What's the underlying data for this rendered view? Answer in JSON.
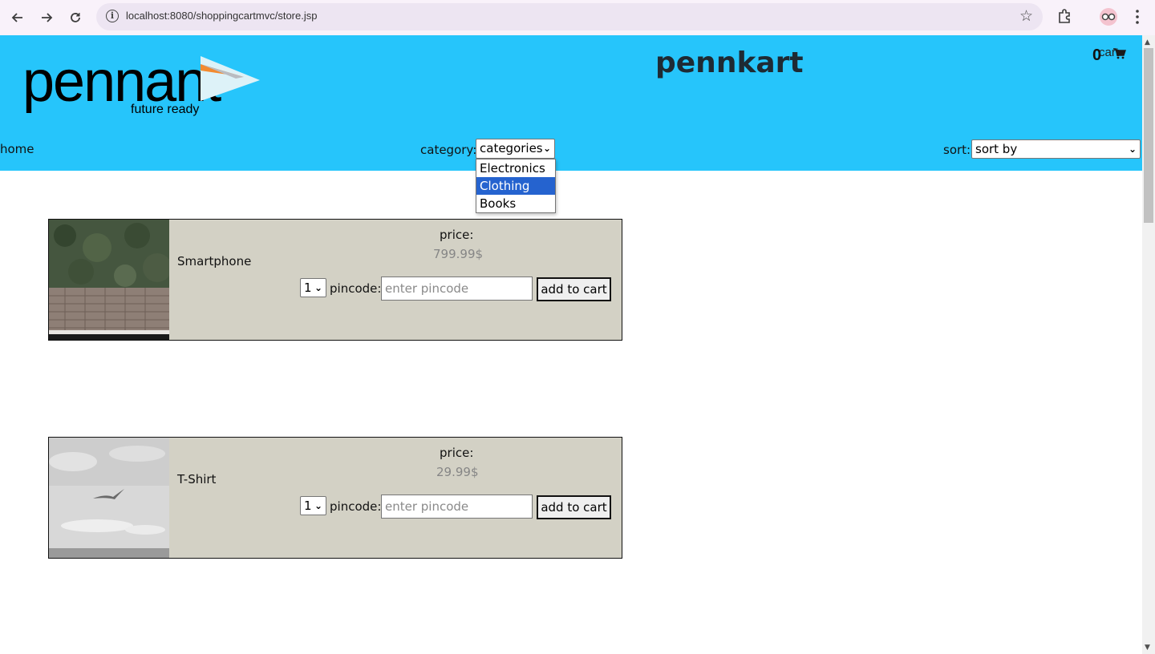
{
  "browser": {
    "url": "localhost:8080/shoppingcartmvc/store.jsp"
  },
  "header": {
    "logo_text": "pennant",
    "logo_tagline": "future ready",
    "site_title": "pennkart",
    "cart_count": "0",
    "cart_label": "cart"
  },
  "nav": {
    "home_label": "home",
    "category_label": "category:",
    "category_selected": "categories",
    "category_options": [
      "Electronics",
      "Clothing",
      "Books"
    ],
    "category_highlighted": "Clothing",
    "sort_label": "sort:",
    "sort_selected": "sort by"
  },
  "products": [
    {
      "name": "Smartphone",
      "price_label": "price:",
      "price": "799.99$",
      "quantity": "1",
      "pincode_label": "pincode::",
      "pincode_placeholder": "enter pincode",
      "add_label": "add to cart"
    },
    {
      "name": "T-Shirt",
      "price_label": "price:",
      "price": "29.99$",
      "quantity": "1",
      "pincode_label": "pincode::",
      "pincode_placeholder": "enter pincode",
      "add_label": "add to cart"
    }
  ],
  "colors": {
    "header_bg": "#26c5fb",
    "card_bg": "#d3d1c5",
    "dropdown_highlight": "#2563cf",
    "logo_orange": "#f28a30"
  }
}
